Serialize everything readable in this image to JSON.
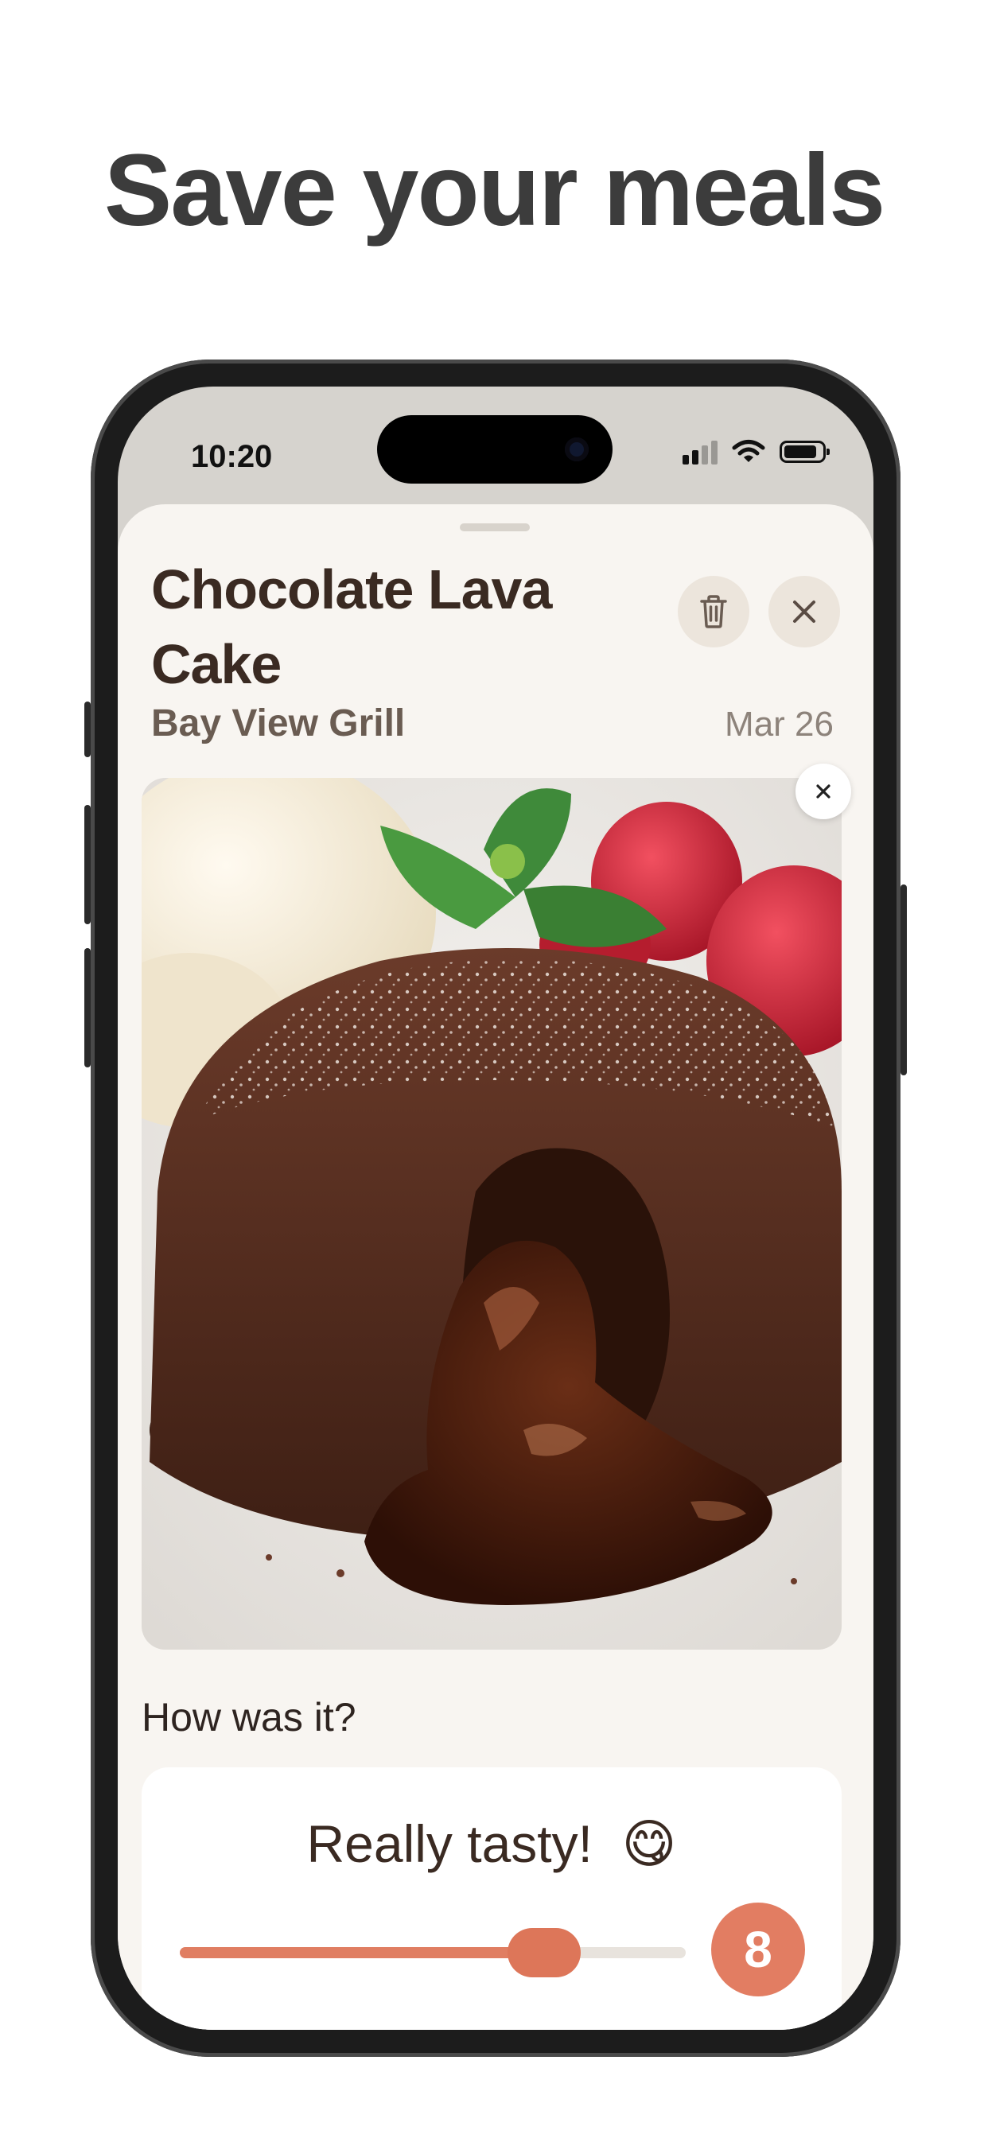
{
  "headline": "Save your meals",
  "status_bar": {
    "time": "10:20"
  },
  "meal": {
    "title": "Chocolate Lava Cake",
    "restaurant": "Bay View Grill",
    "date": "Mar 26"
  },
  "rating": {
    "prompt": "How was it?",
    "label": "Really tasty!",
    "emoji": "😋",
    "score": "8",
    "slider_level": 0.72
  },
  "colors": {
    "accent": "#e27d62",
    "sheet_background": "#f8f5f1",
    "title_text": "#3a2a22"
  },
  "icons": {
    "delete": "trash-icon",
    "close": "close-icon",
    "remove_photo": "close-icon"
  }
}
